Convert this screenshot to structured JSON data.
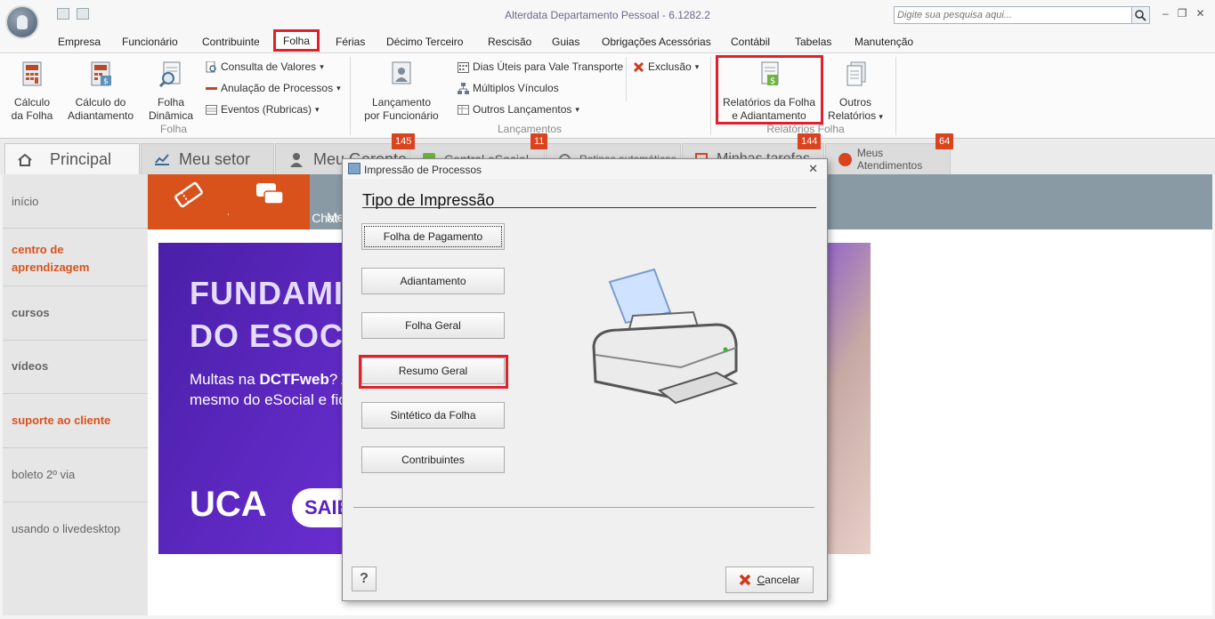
{
  "window": {
    "title": "Alterdata Departamento Pessoal - 6.1282.2",
    "search_placeholder": "Digite sua pesquisa aqui...",
    "controls": {
      "minimize": "–",
      "restore": "❐",
      "close": "✕"
    }
  },
  "menu": {
    "items": [
      "Empresa",
      "Funcionário",
      "Contribuinte",
      "Folha",
      "Férias",
      "Décimo Terceiro",
      "Rescisão",
      "Guias",
      "Obrigações Acessórias",
      "Contábil",
      "Tabelas",
      "Manutenção"
    ],
    "active": "Folha"
  },
  "ribbon": {
    "calculo_folha": [
      "Cálculo",
      "da Folha"
    ],
    "calculo_adiantamento": [
      "Cálculo do",
      "Adiantamento"
    ],
    "folha_dinamica": [
      "Folha",
      "Dinâmica"
    ],
    "consulta_valores": "Consulta de Valores",
    "anulacao_processos": "Anulação de Processos",
    "eventos_rubricas": "Eventos (Rubricas)",
    "group_folha": "Folha",
    "lancamento_funcionario": [
      "Lançamento",
      "por Funcionário"
    ],
    "dias_uteis": "Dias Úteis para Vale Transporte",
    "multiplos_vinculos": "Múltiplos Vínculos",
    "outros_lancamentos": "Outros Lançamentos",
    "exclusao": "Exclusão",
    "group_lancamentos": "Lançamentos",
    "relatorios_folha": [
      "Relatórios da Folha",
      "e Adiantamento"
    ],
    "outros_relatorios": [
      "Outros",
      "Relatórios"
    ],
    "group_relatorios": "Relatórios Folha",
    "dropdown_arrow": "▾"
  },
  "page_tabs": {
    "principal": "Principal",
    "meu_setor": "Meu setor",
    "meu_gerente": "Meu Gerente",
    "central_esocial": "Central eSocial",
    "rotinas": "Rotinas automáticas",
    "minhas_tarefas": "Minhas tarefas",
    "meus_atendimentos": "Meus Atendimentos",
    "badges": [
      "145",
      "11",
      "144",
      "64"
    ]
  },
  "sidebar": {
    "items": [
      "início",
      "centro de aprendizagem",
      "cursos",
      "vídeos",
      "suporte ao cliente",
      "boleto 2º via",
      "usando o livedesktop"
    ]
  },
  "main": {
    "tiles": [
      "Ticket",
      "Chat",
      "Me"
    ],
    "banner": {
      "line1": "FUNDAMI",
      "line2": "DO ESOCI",
      "text_prefix": "Multas na ",
      "text_bold": "DCTFweb",
      "text_rest": "? A declarações! Garanta agora mesmo do eSocial e fique por d obrigatoriedade, fluxos",
      "logo": "UCA",
      "cta": "SAIB"
    }
  },
  "dialog": {
    "title": "Impressão de Processos",
    "close": "✕",
    "heading": "Tipo de Impressão",
    "buttons": [
      "Folha de Pagamento",
      "Adiantamento",
      "Folha Geral",
      "Resumo Geral",
      "Sintético da Folha",
      "Contribuintes"
    ],
    "help": "?",
    "cancel_label_underlined": "C",
    "cancel_label_rest": "ancelar"
  }
}
